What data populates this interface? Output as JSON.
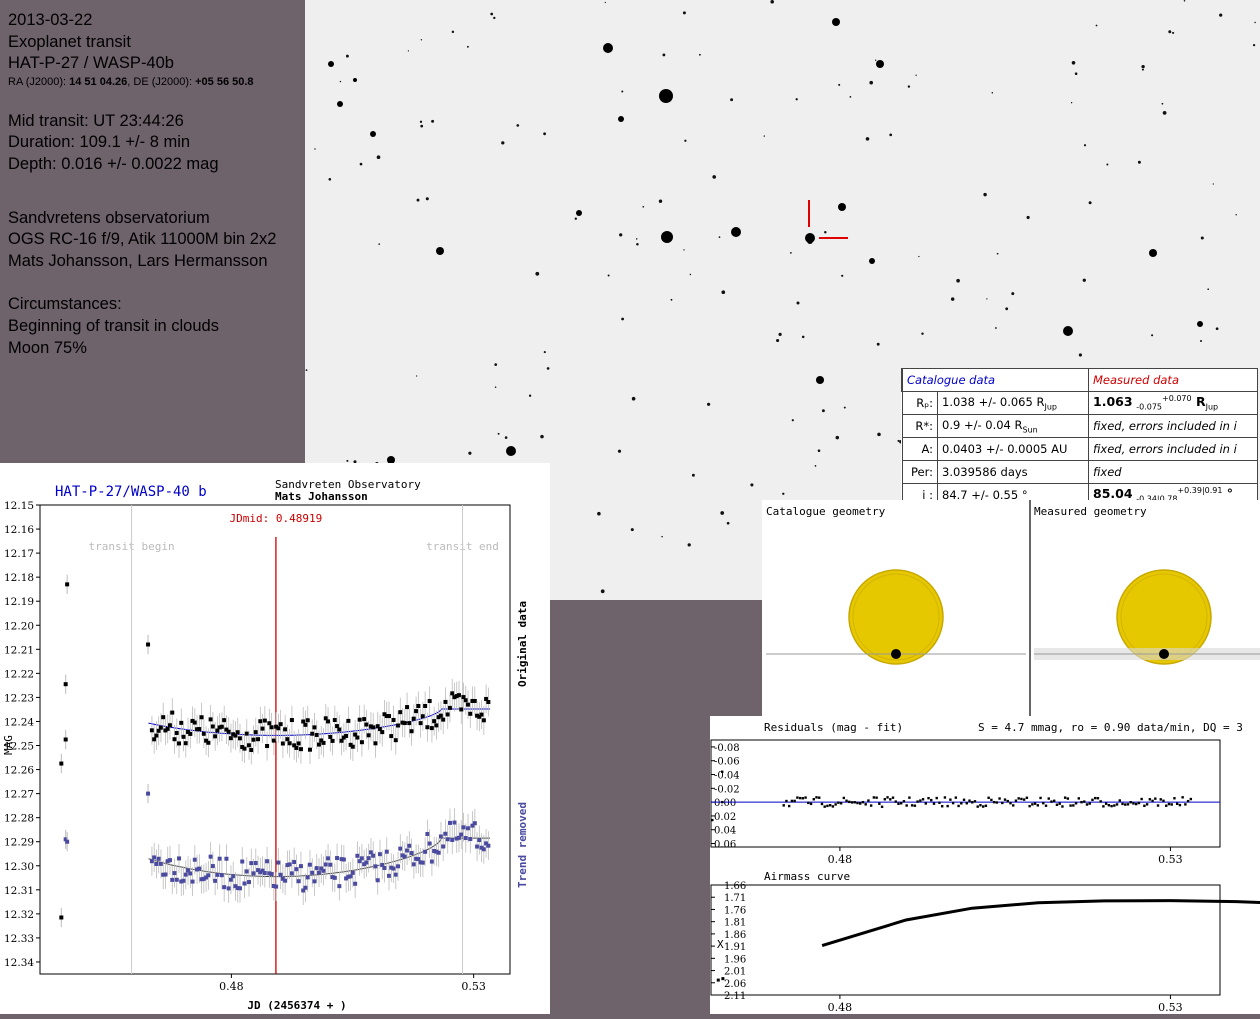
{
  "info": {
    "date": "2013-03-22",
    "type": "Exoplanet transit",
    "target": "HAT-P-27 / WASP-40b",
    "coords": {
      "ra_label": "RA (J2000): ",
      "ra": "14 51 04.26",
      "sep": ", DE (J2000): ",
      "de": "+05 56 50.8"
    },
    "mid_transit": "Mid transit: UT 23:44:26",
    "duration": "Duration: 109.1 +/- 8 min",
    "depth": "Depth: 0.016 +/- 0.0022 mag",
    "observatory": "Sandvretens observatorium",
    "equipment": "OGS RC-16 f/9, Atik 11000M bin 2x2",
    "observers": "Mats Johansson, Lars Hermansson",
    "circ_title": "Circumstances:",
    "circ_1": "Beginning of transit in clouds",
    "circ_2": "Moon 75%"
  },
  "table": {
    "head_cat": "Catalogue data",
    "head_meas": "Measured data",
    "rows": [
      {
        "label": "Rₚ:",
        "cat": "1.038 +/- 0.065 R",
        "cat_sub": "Jup",
        "meas_main": "1.063",
        "meas_sub": "-0.075",
        "meas_sup": "+0.070",
        "meas_unit": " R",
        "meas_unit_sub": "Jup"
      },
      {
        "label": "R*:",
        "cat": "0.9 +/- 0.04 R",
        "cat_sub": "Sun",
        "meas": "fixed, errors included in i"
      },
      {
        "label": "A:",
        "cat": "0.0403 +/- 0.0005 AU",
        "meas": "fixed, errors included in i"
      },
      {
        "label": "Per:",
        "cat": "3.039586 days",
        "meas": "fixed"
      },
      {
        "label": "i :",
        "cat": "84.7 +/- 0.55 °",
        "meas_main": "85.04",
        "meas_sub": "-0.34|0.78",
        "meas_sup": "+0.39|0.91",
        "meas_unit": " °"
      }
    ]
  },
  "geometry": {
    "catalogue": "Catalogue geometry",
    "measured": "Measured geometry",
    "star_color": "#e6c800",
    "planet_color": "#000000"
  },
  "lightcurve": {
    "title": "HAT-P-27/WASP-40 b",
    "observatory": "Sandvreten Observatory",
    "observer": "Mats Johansson",
    "jdmid_label": "JDmid: 0.48919",
    "transit_begin": "transit begin",
    "transit_end": "transit end",
    "ylabel": "MAG",
    "xlabel": "JD (2456374 + )",
    "label_orig": "Original data",
    "label_trend": "Trend removed"
  },
  "residuals": {
    "title": "Residuals (mag - fit)",
    "stats": "S = 4.7 mmag, ro = 0.90 data/min, DQ = 3"
  },
  "airmass": {
    "title": "Airmass curve",
    "ylabel": "X"
  },
  "chart_data": [
    {
      "type": "scatter",
      "title": "HAT-P-27/WASP-40 b",
      "xlabel": "JD (2456374 + )",
      "ylabel": "MAG",
      "xlim": [
        0.4405,
        0.5375
      ],
      "ylim": [
        12.15,
        12.345
      ],
      "ytick_values": [
        12.15,
        12.16,
        12.17,
        12.18,
        12.19,
        12.2,
        12.21,
        12.22,
        12.23,
        12.24,
        12.25,
        12.26,
        12.27,
        12.28,
        12.29,
        12.3,
        12.31,
        12.32,
        12.33,
        12.34
      ],
      "xtick_values": [
        0.48,
        0.53
      ],
      "xticks": [
        "0.48",
        "0.53"
      ],
      "jd_mid": 0.48919,
      "transit_begin": 0.4594,
      "transit_end": 0.5277,
      "series": [
        {
          "name": "Original data",
          "color": "#000000",
          "baseline": 12.2348,
          "depth": 0.011,
          "start_mag": 12.228,
          "end_mag": 12.236
        },
        {
          "name": "Trend removed",
          "color": "#4a4aa0",
          "baseline": 12.2885,
          "depth": 0.016,
          "start_mag": 12.295,
          "end_mag": 12.2885
        }
      ],
      "early_points": [
        {
          "x": 0.4449,
          "y": 12.2575
        },
        {
          "x": 0.4449,
          "y": 12.3215
        },
        {
          "x": 0.4458,
          "y": 12.2245
        },
        {
          "x": 0.4458,
          "y": 12.2475
        },
        {
          "x": 0.4458,
          "y": 12.289
        },
        {
          "x": 0.4461,
          "y": 12.183
        },
        {
          "x": 0.4461,
          "y": 12.29
        },
        {
          "x": 0.4628,
          "y": 12.208
        },
        {
          "x": 0.4628,
          "y": 12.27
        }
      ]
    },
    {
      "type": "scatter",
      "title": "Residuals (mag - fit)",
      "xlim": [
        0.4605,
        0.5375
      ],
      "ylim": [
        -0.09,
        0.065
      ],
      "ytick_values": [
        -0.08,
        -0.06,
        -0.04,
        -0.02,
        0.0,
        0.02,
        0.04,
        0.06
      ],
      "yticks": [
        "-0.08",
        "-0.06",
        "-0.04",
        "-0.02",
        "0.00",
        "0.02",
        "0.04",
        "0.06"
      ],
      "xtick_values": [
        0.48,
        0.53
      ],
      "xticks": [
        "0.48",
        "0.53"
      ],
      "points": [
        {
          "x": 0.4622,
          "y": -0.044
        },
        {
          "x": 0.4622,
          "y": 0.0
        },
        {
          "x": 0.4607,
          "y": 0.026
        }
      ]
    },
    {
      "type": "line",
      "title": "Airmass curve",
      "ylabel": "X",
      "xlim": [
        0.4605,
        0.5375
      ],
      "ylim": [
        1.66,
        2.11
      ],
      "ytick_values": [
        1.66,
        1.71,
        1.76,
        1.81,
        1.86,
        1.91,
        1.96,
        2.01,
        2.06,
        2.11
      ],
      "yticks": [
        "1.66",
        "1.71",
        "1.76",
        "1.81",
        "1.86",
        "1.91",
        "1.96",
        "2.01",
        "2.06",
        "2.11"
      ],
      "xtick_values": [
        0.48,
        0.53
      ],
      "xticks": [
        "0.48",
        "0.53"
      ],
      "curve": [
        {
          "x": 0.4773,
          "y": 1.908
        },
        {
          "x": 0.49,
          "y": 1.803
        },
        {
          "x": 0.5,
          "y": 1.755
        },
        {
          "x": 0.51,
          "y": 1.733
        },
        {
          "x": 0.52,
          "y": 1.725
        },
        {
          "x": 0.53,
          "y": 1.724
        },
        {
          "x": 0.54,
          "y": 1.728
        },
        {
          "x": 0.5517,
          "y": 1.74
        }
      ],
      "points": [
        {
          "x": 0.4616,
          "y": 2.049
        },
        {
          "x": 0.4623,
          "y": 2.043
        }
      ]
    }
  ]
}
